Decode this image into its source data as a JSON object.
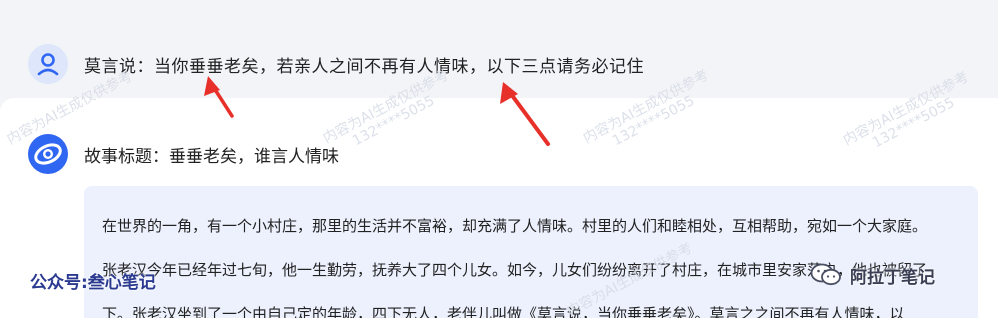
{
  "user_message": {
    "text": "莫言说：当你垂垂老矣，若亲人之间不再有人情味，以下三点请务必记住",
    "avatar_icon": "user-icon"
  },
  "bot_reply": {
    "logo_icon": "ai-assistant-logo-icon",
    "title": "故事标题：垂垂老矣，谁言人情味",
    "paragraphs": [
      "在世界的一角，有一个小村庄，那里的生活并不富裕，却充满了人情味。村里的人们和睦相处，互相帮助，宛如一个大家庭。",
      "张老汉今年已经年过七旬，他一生勤劳，抚养大了四个儿女。如今，儿女们纷纷离开了村庄，在城市里安家落户，他也被留了",
      "下。张老汉坐到了一个由自己定的年龄，四下无人，老伴儿叫做《莫言说，当你垂垂老矣》。莫言之之间不再有人情味，以"
    ]
  },
  "watermarks": {
    "ai_notice": "内容为AI生成仅供参考",
    "phone": "132****5055",
    "bottom_left": "公众号:叁心笔记",
    "bottom_right": "阿拉丁笔记"
  },
  "colors": {
    "page_bg": "#f3f4f8",
    "panel_bg": "#ffffff",
    "story_bg": "#ecf1fd",
    "accent_blue": "#2f66f2",
    "arrow_red": "#e8302a"
  }
}
